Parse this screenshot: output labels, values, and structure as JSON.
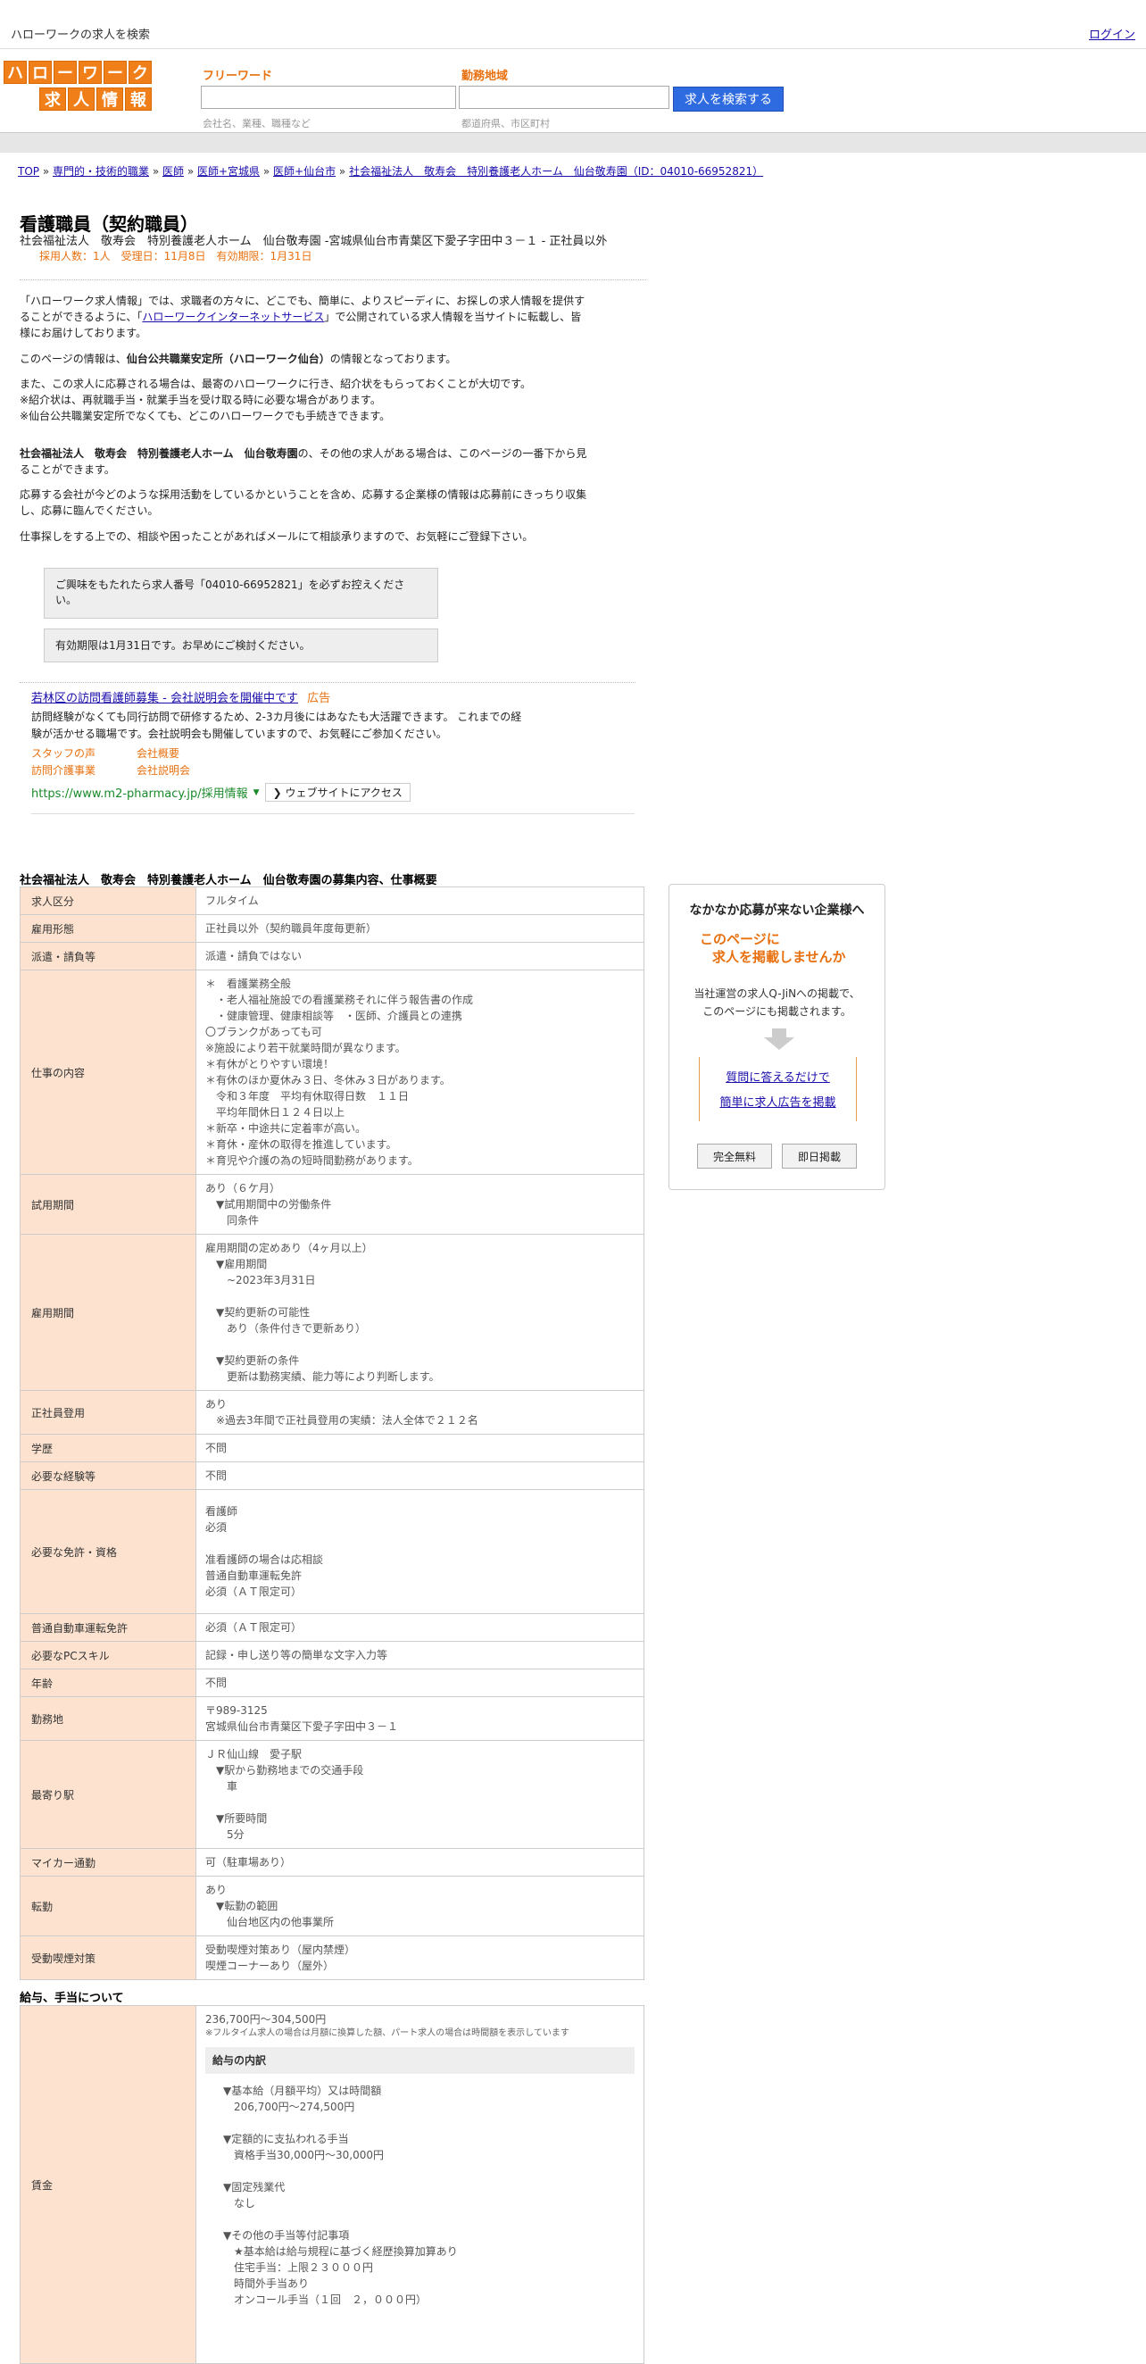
{
  "topbar": {
    "title": "ハローワークの求人を検索",
    "login": "ログイン"
  },
  "logo": {
    "row1": [
      "ハ",
      "ロ",
      "ー",
      "ワ",
      "ー",
      "ク"
    ],
    "row2": [
      "求",
      "人",
      "情",
      "報"
    ]
  },
  "search": {
    "keyword_label": "フリーワード",
    "keyword_hint": "会社名、業種、職種など",
    "area_label": "勤務地域",
    "area_hint": "都道府県、市区町村",
    "button": "求人を検索する"
  },
  "breadcrumb": {
    "items": [
      "TOP",
      "専門的・技術的職業",
      "医師",
      "医師+宮城県",
      "医師+仙台市",
      "社会福祉法人　敬寿会　特別養護老人ホーム　仙台敬寿園（ID：04010-66952821）"
    ],
    "sep": " » "
  },
  "job": {
    "title": "看護職員（契約職員）",
    "subtitle": "社会福祉法人　敬寿会　特別養護老人ホーム　仙台敬寿園 -宮城県仙台市青葉区下愛子字田中３－１ - 正社員以外",
    "meta": "採用人数：1人　受理日：11月8日　有効期限：1月31日"
  },
  "intro": {
    "p1a": "「ハローワーク求人情報」では、求職者の方々に、どこでも、簡単に、よりスピーディに、お探しの求人情報を提供す",
    "p1b": "ることができるように、「",
    "p1link": "ハローワークインターネットサービス",
    "p1c": "」で公開されている求人情報を当サイトに転載し、皆",
    "p1d": "様にお届けしております。",
    "p2a": "このページの情報は、",
    "p2b": "仙台公共職業安定所（ハローワーク仙台）",
    "p2c": "の情報となっております。",
    "p3a": "また、この求人に応募される場合は、最寄のハローワークに行き、紹介状をもらっておくことが大切です。",
    "p3b": "※紹介状は、再就職手当・就業手当を受け取る時に必要な場合があります。",
    "p3c": "※仙台公共職業安定所でなくても、どこのハローワークでも手続きできます。",
    "p4a": "社会福祉法人　敬寿会　特別養護老人ホーム　仙台敬寿園",
    "p4b": "の、その他の求人がある場合は、このページの一番下から見",
    "p4c": "ることができます。",
    "p5a": "応募する会社が今どのような採用活動をしているかということを含め、応募する企業様の情報は応募前にきっちり収集",
    "p5b": "し、応募に臨んでください。",
    "p6": "仕事探しをする上での、相談や困ったことがあればメールにて相談承りますので、お気軽にご登録下さい。"
  },
  "notices": [
    {
      "line1": "ご興味をもたれたら求人番号「04010-66952821」を必ずお控えくださ",
      "line2": "い。"
    },
    {
      "line1": "有効期限は1月31日です。お早めにご検討ください。",
      "line2": ""
    }
  ],
  "ad": {
    "headline": "若林区の訪問看護師募集 - 会社説明会を開催中です",
    "badge": "広告",
    "desc1": "訪問経験がなくても同行訪問で研修するため、2-3カ月後にはあなたも大活躍できます。 これまでの経",
    "desc2": "験が活かせる職場です。会社説明会も開催していますので、お気軽にご参加ください。",
    "links": [
      "スタッフの声",
      "会社概要",
      "訪問介護事業",
      "会社説明会"
    ],
    "url": "https://www.m2-pharmacy.jp/採用情報",
    "cta": "ウェブサイトにアクセス"
  },
  "table_title": "社会福祉法人　敬寿会　特別養護老人ホーム　仙台敬寿園の募集内容、仕事概要",
  "rows": [
    {
      "k": "求人区分",
      "v": "フルタイム"
    },
    {
      "k": "雇用形態",
      "v": "正社員以外（契約職員年度毎更新）"
    },
    {
      "k": "派遣・請負等",
      "v": "派遣・請負ではない"
    },
    {
      "k": "仕事の内容",
      "v": "＊　看護業務全般\n　・老人福祉施設での看護業務それに伴う報告書の作成\n　・健康管理、健康相談等　・医師、介護員との連携\n〇ブランクがあっても可\n※施設により若干就業時間が異なります。\n＊有休がとりやすい環境！\n＊有休のほか夏休み３日、冬休み３日があります。\n　令和３年度　平均有休取得日数　１１日\n　平均年間休日１２４日以上\n＊新卒・中途共に定着率が高い。\n＊育休・産休の取得を推進しています。\n＊育児や介護の為の短時間勤務があります。"
    },
    {
      "k": "試用期間",
      "v": "あり（６ケ月）\n　▼試用期間中の労働条件\n　　同条件"
    },
    {
      "k": "雇用期間",
      "v": "雇用期間の定めあり（4ヶ月以上）\n　▼雇用期間\n　　~2023年3月31日\n\n　▼契約更新の可能性\n　　あり（条件付きで更新あり）\n\n　▼契約更新の条件\n　　更新は勤務実績、能力等により判断します。"
    },
    {
      "k": "正社員登用",
      "v": "あり\n　※過去3年間で正社員登用の実績：法人全体で２１２名"
    },
    {
      "k": "学歴",
      "v": "不問"
    },
    {
      "k": "必要な経験等",
      "v": "不問"
    },
    {
      "k": "必要な免許・資格",
      "v": "看護師\n必須\n\n准看護師の場合は応相談\n普通自動車運転免許\n必須（ＡＴ限定可）\n"
    },
    {
      "k": "普通自動車運転免許",
      "v": "必須（ＡＴ限定可）"
    },
    {
      "k": "必要なPCスキル",
      "v": "記録・申し送り等の簡単な文字入力等"
    },
    {
      "k": "年齢",
      "v": "不問"
    },
    {
      "k": "勤務地",
      "v": "〒989-3125\n宮城県仙台市青葉区下愛子字田中３－１"
    },
    {
      "k": "最寄り駅",
      "v": "ＪＲ仙山線　愛子駅\n　▼駅から勤務地までの交通手段\n　　車\n\n　▼所要時間\n　　5分"
    },
    {
      "k": "マイカー通勤",
      "v": "可（駐車場あり）"
    },
    {
      "k": "転勤",
      "v": "あり\n　▼転勤の範囲\n　　仙台地区内の他事業所"
    },
    {
      "k": "受動喫煙対策",
      "v": "受動喫煙対策あり（屋内禁煙）\n喫煙コーナーあり（屋外）"
    }
  ],
  "side": {
    "title": "なかなか応募が来ない企業様へ",
    "catch1": "このページに",
    "catch2": "求人を掲載しませんか",
    "desc1": "当社運営の求人Q-JiNへの掲載で、",
    "desc2": "このページにも掲載されます。",
    "link1": "質問に答えるだけで",
    "link2": "簡単に求人広告を掲載",
    "btn1": "完全無料",
    "btn2": "即日掲載"
  },
  "salary": {
    "title": "給与、手当について",
    "key": "賃金",
    "range": "236,700円〜304,500円",
    "note": "※フルタイム求人の場合は月額に換算した額、パート求人の場合は時間額を表示しています",
    "breakdown_title": "給与の内訳",
    "breakdown": "▼基本給（月額平均）又は時間額\n　206,700円〜274,500円\n\n▼定額的に支払われる手当\n　資格手当30,000円〜30,000円\n\n▼固定残業代\n　なし\n\n▼その他の手当等付記事項\n　★基本給は給与規程に基づく経歴換算加算あり\n　住宅手当：上限２３０００円\n　時間外手当あり\n　オンコール手当（１回　２，０００円）"
  }
}
